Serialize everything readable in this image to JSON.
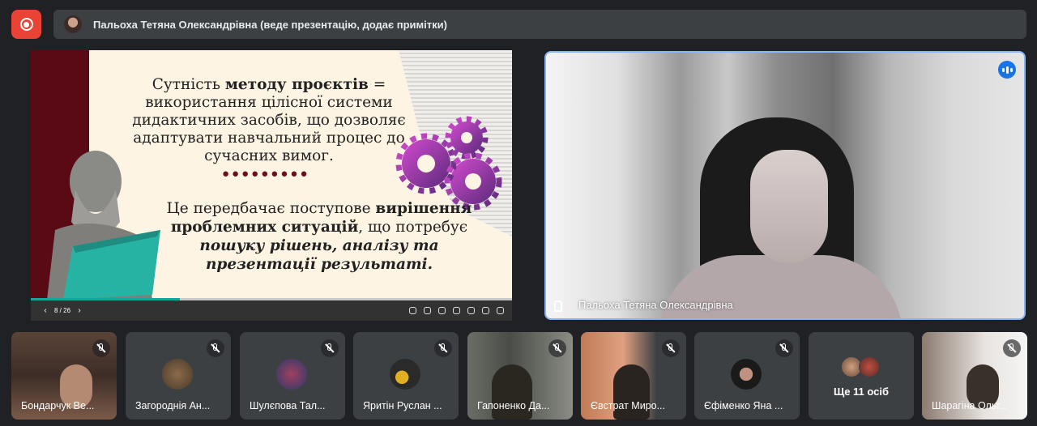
{
  "recording": {
    "icon": "record-icon",
    "color": "#ea4335"
  },
  "banner": {
    "text": "Пальоха Тетяна Олександрівна (веде презентацію, додає примітки)"
  },
  "slide": {
    "text1_pre": "Сутність ",
    "text1_bold": "методу проєктів",
    "text1_post": " = використання цілісної системи дидактичних засобів, що дозволяє адаптувати навчальний процес до сучасних вимог.",
    "dots": "●●●●●●●●●",
    "text2_pre": "Це передбачає поступове ",
    "text2_bold": "вирішення проблемних ситуацій",
    "text2_mid": ", що потребує ",
    "text2_italic": "пошуку рішень, аналізу та презентації результаті.",
    "page": "8 / 26",
    "prev": "‹",
    "next": "›",
    "progress": 0.31
  },
  "speaker": {
    "name": "Пальоха Тетяна Олександрівна",
    "border_color": "#8ab4f8"
  },
  "participants": [
    {
      "name": "Бондарчук Ве..."
    },
    {
      "name": "Загороднія Ан..."
    },
    {
      "name": "Шулєпова Тал..."
    },
    {
      "name": "Яритін Руслан ..."
    },
    {
      "name": "Гапоненко Да..."
    },
    {
      "name": "Євстрат Миро..."
    },
    {
      "name": "Єфіменко Яна ..."
    },
    {
      "name": "Шарагіна Ольг..."
    }
  ],
  "more": {
    "label": "Ще 11 осіб"
  }
}
